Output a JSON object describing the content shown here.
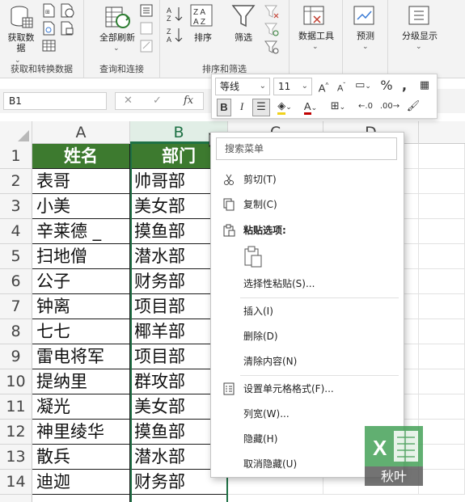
{
  "ribbon": {
    "groups": [
      {
        "label": "获取和转换数据"
      },
      {
        "label": "查询和连接"
      },
      {
        "label": "排序和筛选"
      }
    ],
    "buttons": {
      "get_data": "获取数\n据",
      "refresh_all": "全部刷新",
      "sort": "排序",
      "filter": "筛选",
      "data_tools": "数据工具",
      "forecast": "预测",
      "outline": "分级显示"
    }
  },
  "formula_bar": {
    "name_box": "B1",
    "fx": "fx"
  },
  "mini_toolbar": {
    "font_name": "等线",
    "font_size": "11",
    "bold": "B",
    "italic": "I",
    "percent": "%",
    "comma": "9"
  },
  "grid": {
    "columns": [
      "A",
      "B",
      "C",
      "D"
    ],
    "selected_column": "B",
    "rows": [
      {
        "n": "1",
        "a": "姓名",
        "b": "部门"
      },
      {
        "n": "2",
        "a": "表哥",
        "b": "帅哥部"
      },
      {
        "n": "3",
        "a": "小美",
        "b": "美女部"
      },
      {
        "n": "4",
        "a": "辛莱德 _",
        "b": "摸鱼部"
      },
      {
        "n": "5",
        "a": "扫地僧",
        "b": "潜水部"
      },
      {
        "n": "6",
        "a": "公子",
        "b": "财务部"
      },
      {
        "n": "7",
        "a": "钟离",
        "b": "项目部"
      },
      {
        "n": "8",
        "a": "七七",
        "b": "椰羊部"
      },
      {
        "n": "9",
        "a": "雷电将军",
        "b": "项目部"
      },
      {
        "n": "10",
        "a": "提纳里",
        "b": "群攻部"
      },
      {
        "n": "11",
        "a": "凝光",
        "b": "美女部"
      },
      {
        "n": "12",
        "a": "神里绫华",
        "b": "摸鱼部"
      },
      {
        "n": "13",
        "a": "散兵",
        "b": "潜水部"
      },
      {
        "n": "14",
        "a": "迪迦",
        "b": "财务部"
      }
    ]
  },
  "context_menu": {
    "search_placeholder": "搜索菜单",
    "cut": "剪切(T)",
    "copy": "复制(C)",
    "paste_options": "粘贴选项:",
    "paste_special": "选择性粘贴(S)...",
    "insert": "插入(I)",
    "delete": "删除(D)",
    "clear": "清除内容(N)",
    "format_cells": "设置单元格格式(F)...",
    "column_width": "列宽(W)...",
    "hide": "隐藏(H)",
    "unhide": "取消隐藏(U)"
  },
  "watermark": {
    "text": "秋叶",
    "letter": "X"
  },
  "colors": {
    "header_fill": "#3d7a2f",
    "excel_green": "#1e7145"
  }
}
